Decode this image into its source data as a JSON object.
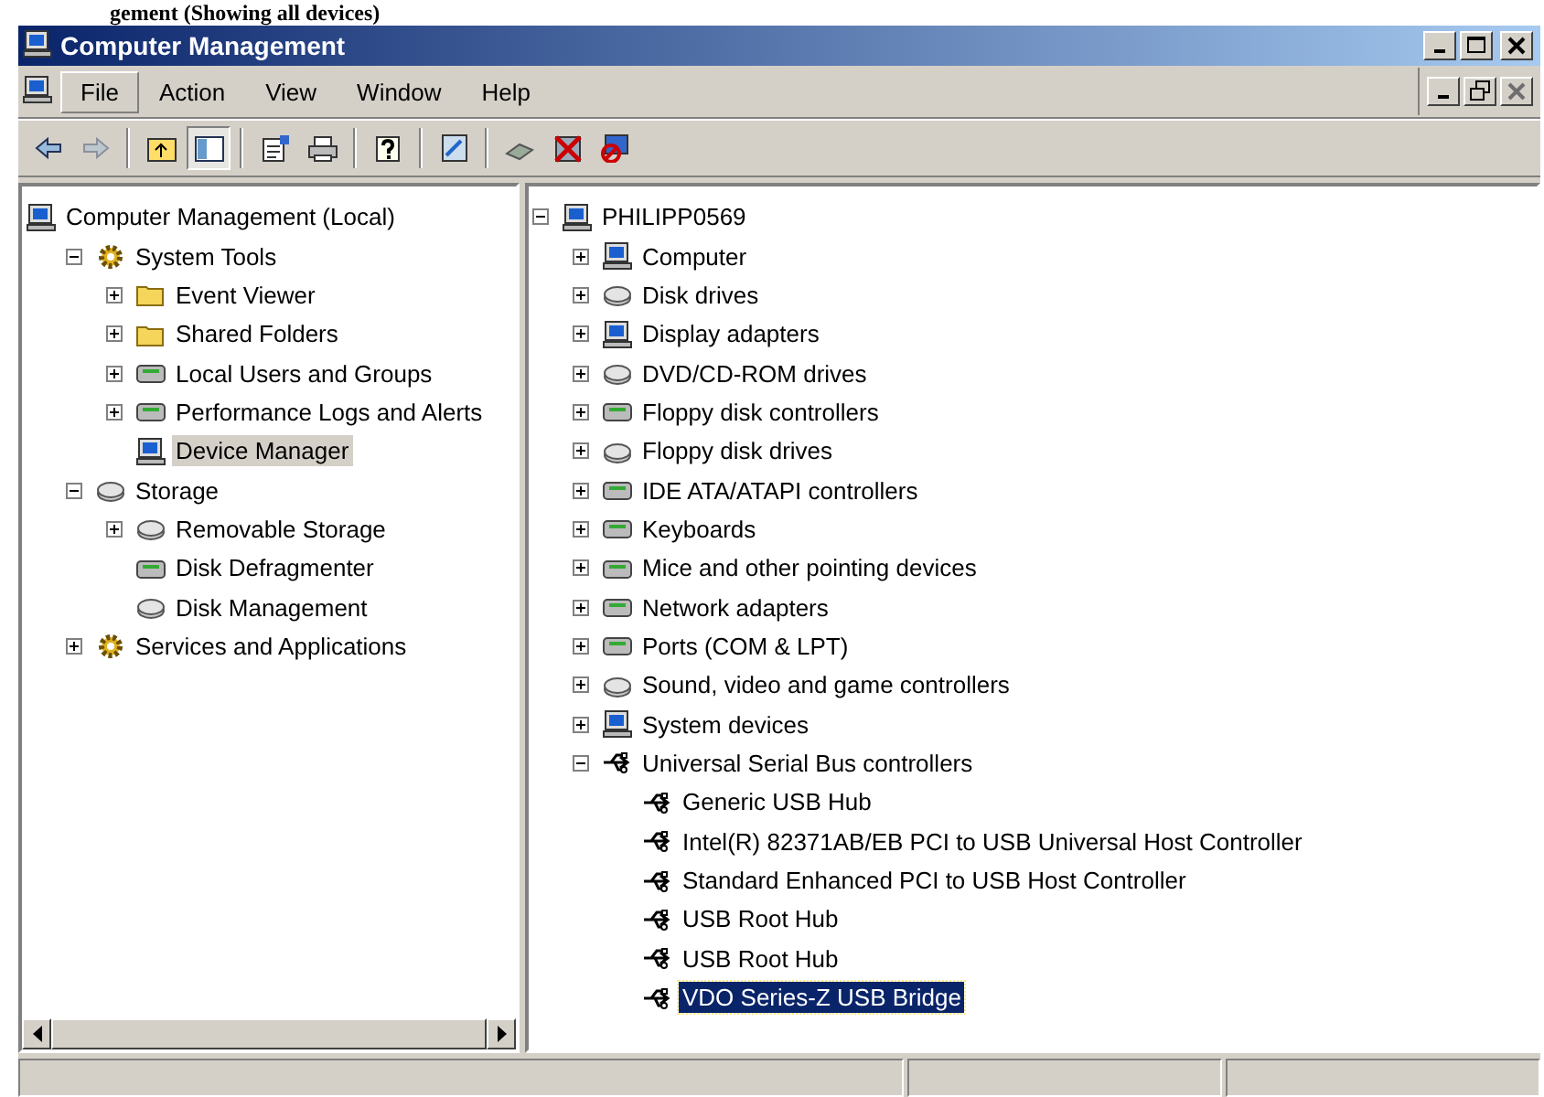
{
  "caption": "gement (Showing all devices)",
  "window": {
    "title": "Computer Management"
  },
  "menu": [
    {
      "label": "File",
      "hot": true
    },
    {
      "label": "Action",
      "hot": false
    },
    {
      "label": "View",
      "hot": false
    },
    {
      "label": "Window",
      "hot": false
    },
    {
      "label": "Help",
      "hot": false
    }
  ],
  "toolbar": [
    {
      "kind": "back",
      "disabled": false,
      "pressed": false
    },
    {
      "kind": "forward",
      "disabled": true,
      "pressed": false
    },
    {
      "kind": "sep"
    },
    {
      "kind": "up",
      "disabled": false,
      "pressed": false
    },
    {
      "kind": "tree",
      "disabled": false,
      "pressed": true
    },
    {
      "kind": "sep"
    },
    {
      "kind": "properties",
      "disabled": false,
      "pressed": false
    },
    {
      "kind": "print",
      "disabled": false,
      "pressed": false
    },
    {
      "kind": "sep"
    },
    {
      "kind": "help",
      "disabled": false,
      "pressed": false
    },
    {
      "kind": "sep"
    },
    {
      "kind": "scan",
      "disabled": false,
      "pressed": false
    },
    {
      "kind": "sep"
    },
    {
      "kind": "update",
      "disabled": false,
      "pressed": false
    },
    {
      "kind": "uninstall",
      "disabled": false,
      "pressed": false
    },
    {
      "kind": "disable",
      "disabled": false,
      "pressed": false
    }
  ],
  "left_tree": {
    "focused": false,
    "items": [
      {
        "label": "Computer Management (Local)",
        "kind": "computer",
        "selected": false,
        "children": [
          {
            "label": "System Tools",
            "kind": "gear",
            "expanded": true,
            "selected": false,
            "children": [
              {
                "label": "Event Viewer",
                "kind": "folder",
                "expanded": false,
                "selected": false
              },
              {
                "label": "Shared Folders",
                "kind": "folder",
                "expanded": false,
                "selected": false
              },
              {
                "label": "Local Users and Groups",
                "kind": "device",
                "expanded": false,
                "selected": false
              },
              {
                "label": "Performance Logs and Alerts",
                "kind": "device",
                "expanded": false,
                "selected": false
              },
              {
                "label": "Device Manager",
                "kind": "computer",
                "selected": true
              }
            ]
          },
          {
            "label": "Storage",
            "kind": "disk",
            "expanded": true,
            "selected": false,
            "children": [
              {
                "label": "Removable Storage",
                "kind": "disk",
                "expanded": false,
                "selected": false
              },
              {
                "label": "Disk Defragmenter",
                "kind": "device",
                "selected": false
              },
              {
                "label": "Disk Management",
                "kind": "disk",
                "selected": false
              }
            ]
          },
          {
            "label": "Services and Applications",
            "kind": "gear",
            "expanded": false,
            "selected": false
          }
        ]
      }
    ]
  },
  "right_tree": {
    "focused": true,
    "items": [
      {
        "label": "PHILIPP0569",
        "kind": "computer",
        "expanded": true,
        "selected": false,
        "children": [
          {
            "label": "Computer",
            "kind": "computer",
            "expanded": false,
            "selected": false
          },
          {
            "label": "Disk drives",
            "kind": "disk",
            "expanded": false,
            "selected": false
          },
          {
            "label": "Display adapters",
            "kind": "computer",
            "expanded": false,
            "selected": false
          },
          {
            "label": "DVD/CD-ROM drives",
            "kind": "disk",
            "expanded": false,
            "selected": false
          },
          {
            "label": "Floppy disk controllers",
            "kind": "device",
            "expanded": false,
            "selected": false
          },
          {
            "label": "Floppy disk drives",
            "kind": "disk",
            "expanded": false,
            "selected": false
          },
          {
            "label": "IDE ATA/ATAPI controllers",
            "kind": "device",
            "expanded": false,
            "selected": false
          },
          {
            "label": "Keyboards",
            "kind": "device",
            "expanded": false,
            "selected": false
          },
          {
            "label": "Mice and other pointing devices",
            "kind": "device",
            "expanded": false,
            "selected": false
          },
          {
            "label": "Network adapters",
            "kind": "device",
            "expanded": false,
            "selected": false
          },
          {
            "label": "Ports (COM & LPT)",
            "kind": "device",
            "expanded": false,
            "selected": false
          },
          {
            "label": "Sound, video and game controllers",
            "kind": "disk",
            "expanded": false,
            "selected": false
          },
          {
            "label": "System devices",
            "kind": "computer",
            "expanded": false,
            "selected": false
          },
          {
            "label": "Universal Serial Bus controllers",
            "kind": "usb",
            "expanded": true,
            "selected": false,
            "children": [
              {
                "label": "Generic USB Hub",
                "kind": "usb",
                "selected": false
              },
              {
                "label": "Intel(R) 82371AB/EB PCI to USB Universal Host Controller",
                "kind": "usb",
                "selected": false
              },
              {
                "label": "Standard Enhanced PCI to USB Host Controller",
                "kind": "usb",
                "selected": false
              },
              {
                "label": "USB Root Hub",
                "kind": "usb",
                "selected": false
              },
              {
                "label": "USB Root Hub",
                "kind": "usb",
                "selected": false
              },
              {
                "label": "VDO Series-Z USB Bridge",
                "kind": "usb",
                "selected": true
              }
            ]
          }
        ]
      }
    ]
  }
}
